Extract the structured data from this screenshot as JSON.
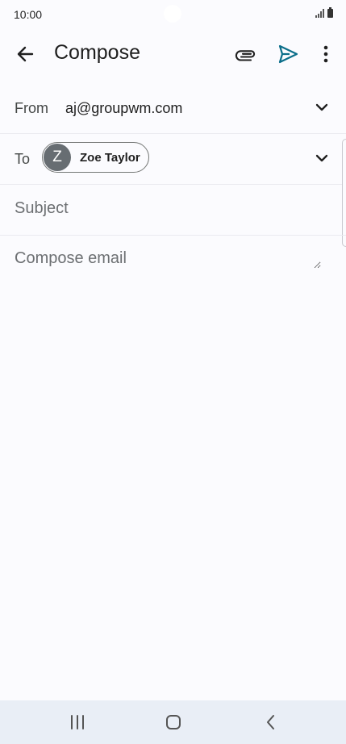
{
  "status_bar": {
    "time": "10:00"
  },
  "app_bar": {
    "title": "Compose"
  },
  "icons": {
    "back": "arrow-back-icon",
    "attach": "paperclip-icon",
    "send": "send-icon",
    "more": "more-vert-icon",
    "expand": "chevron-down-icon"
  },
  "colors": {
    "send_accent": "#0b6e8a",
    "chip_avatar": "#676d72",
    "nav_bar": "#e9eef6"
  },
  "from": {
    "label": "From",
    "value": "aj@groupwm.com"
  },
  "to": {
    "label": "To",
    "recipients": [
      {
        "initial": "Z",
        "name": "Zoe Taylor"
      }
    ]
  },
  "subject": {
    "placeholder": "Subject",
    "value": ""
  },
  "body": {
    "placeholder": "Compose email",
    "value": ""
  }
}
